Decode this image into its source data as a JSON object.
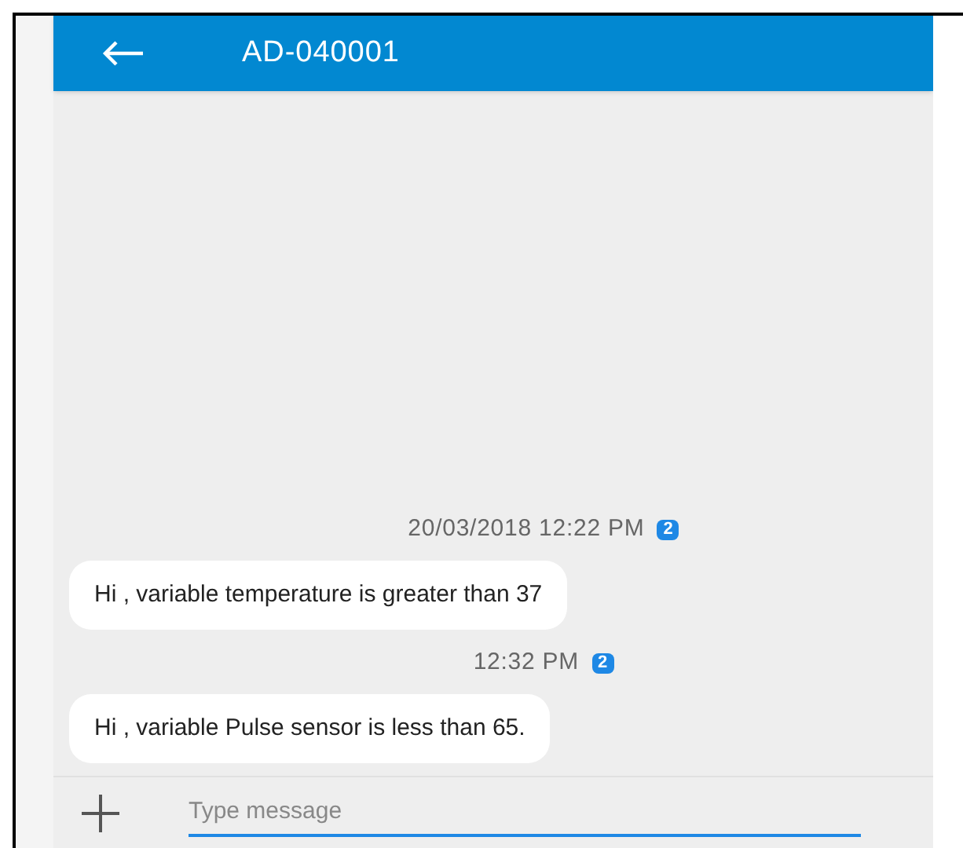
{
  "header": {
    "title": "AD-040001"
  },
  "messages": [
    {
      "timestamp": "20/03/2018 12:22 PM",
      "badge": "2",
      "text": "Hi , variable temperature is greater than 37"
    },
    {
      "timestamp": "12:32 PM",
      "badge": "2",
      "text": "Hi , variable Pulse sensor is less than 65."
    }
  ],
  "composer": {
    "placeholder": "Type message"
  }
}
